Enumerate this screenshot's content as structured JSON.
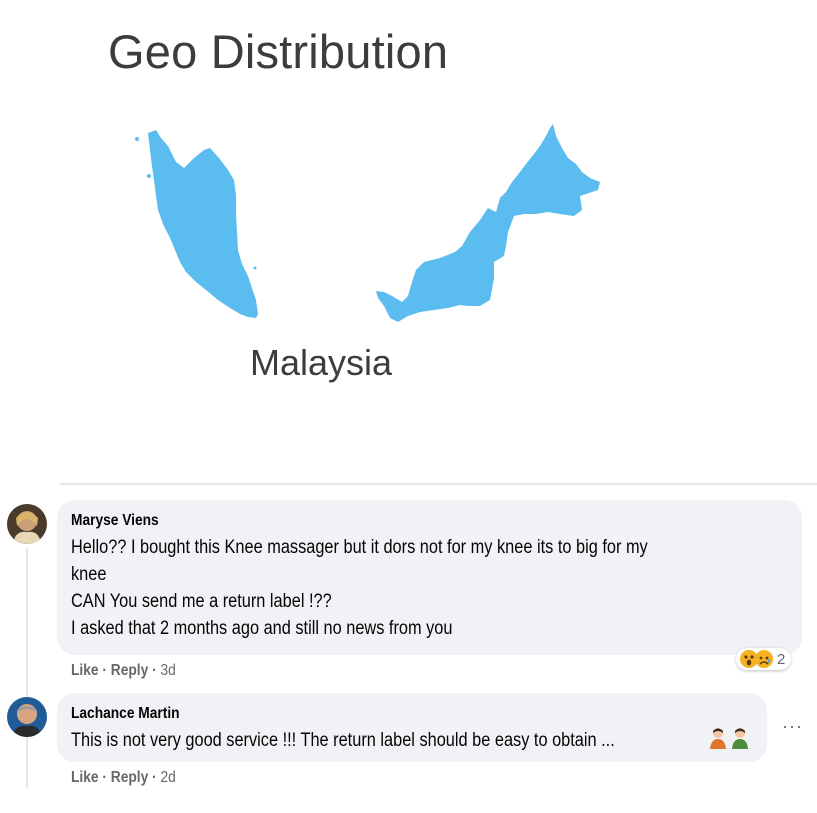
{
  "geo": {
    "title": "Geo Distribution",
    "country_label": "Malaysia",
    "map_color": "#5bbcf0"
  },
  "comments": [
    {
      "author": "Maryse Viens",
      "lines": [
        "Hello?? I bought this Knee massager but it dors not for my knee its to big for my",
        "knee",
        "CAN You send me a return label !??",
        "I asked that 2 months ago and still no news from you"
      ],
      "actions": {
        "like": "Like",
        "reply": "Reply",
        "time": "3d"
      },
      "reactions": {
        "icons": [
          "wow-emoji",
          "sad-emoji"
        ],
        "count": "2"
      }
    },
    {
      "author": "Lachance Martin",
      "lines": [
        "This is not very good service !!! The return label should be easy to obtain ..."
      ],
      "trailing_icons": [
        "person-shrugging-emoji",
        "person-shrugging-emoji"
      ],
      "actions": {
        "like": "Like",
        "reply": "Reply",
        "time": "2d"
      },
      "more": "···"
    }
  ]
}
